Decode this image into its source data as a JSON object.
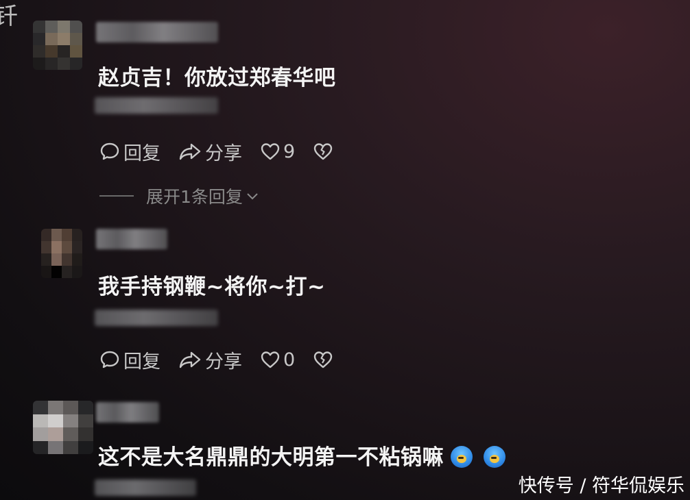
{
  "edge_char": "钎",
  "actions": {
    "reply_label": "回复",
    "share_label": "分享"
  },
  "comments": [
    {
      "text": "赵贞吉！你放过郑春华吧",
      "likes": "9",
      "expand_label": "展开1条回复"
    },
    {
      "text": "我手持钢鞭~将你~打~",
      "likes": "0"
    },
    {
      "text": "这不是大名鼎鼎的大明第一不粘锅嘛"
    }
  ],
  "watermark": "快传号 / 符华侃娱乐",
  "colors": {
    "text": "#f4f4f4",
    "action": "#c8c8c8",
    "muted": "#8a8a8a"
  },
  "icons": [
    "chat-bubble-icon",
    "share-arrow-icon",
    "heart-icon",
    "broken-heart-icon",
    "emoji-icon"
  ]
}
